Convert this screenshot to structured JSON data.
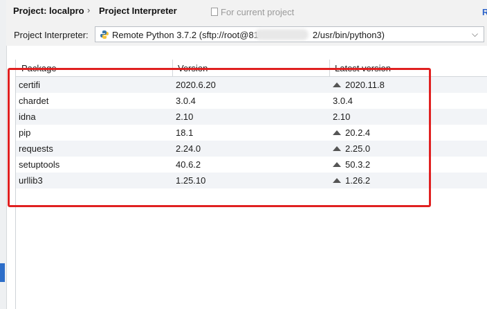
{
  "breadcrumb": {
    "project": "Project: localpro",
    "separator": "›",
    "page": "Project Interpreter"
  },
  "scope_label": "For current project",
  "reset_link": "R",
  "interpreter": {
    "label": "Project Interpreter:",
    "value_prefix": "Remote Python 3.7.2 (sftp://root@81",
    "value_suffix": "2/usr/bin/python3)"
  },
  "table": {
    "headers": {
      "package": "Package",
      "version": "Version",
      "latest": "Latest version"
    },
    "rows": [
      {
        "package": "certifi",
        "version": "2020.6.20",
        "latest": "2020.11.8",
        "upgrade": true
      },
      {
        "package": "chardet",
        "version": "3.0.4",
        "latest": "3.0.4",
        "upgrade": false
      },
      {
        "package": "idna",
        "version": "2.10",
        "latest": "2.10",
        "upgrade": false
      },
      {
        "package": "pip",
        "version": "18.1",
        "latest": "20.2.4",
        "upgrade": true
      },
      {
        "package": "requests",
        "version": "2.24.0",
        "latest": "2.25.0",
        "upgrade": true
      },
      {
        "package": "setuptools",
        "version": "40.6.2",
        "latest": "50.3.2",
        "upgrade": true
      },
      {
        "package": "urllib3",
        "version": "1.25.10",
        "latest": "1.26.2",
        "upgrade": true
      }
    ]
  },
  "colors": {
    "accent": "#2f65ca",
    "highlight": "#e02020",
    "row_alt": "#f2f4f7"
  },
  "icons": {
    "upgrade": "up-arrow-icon",
    "python": "python-icon",
    "dropdown": "chevron-down-icon",
    "scope": "scope-icon"
  }
}
